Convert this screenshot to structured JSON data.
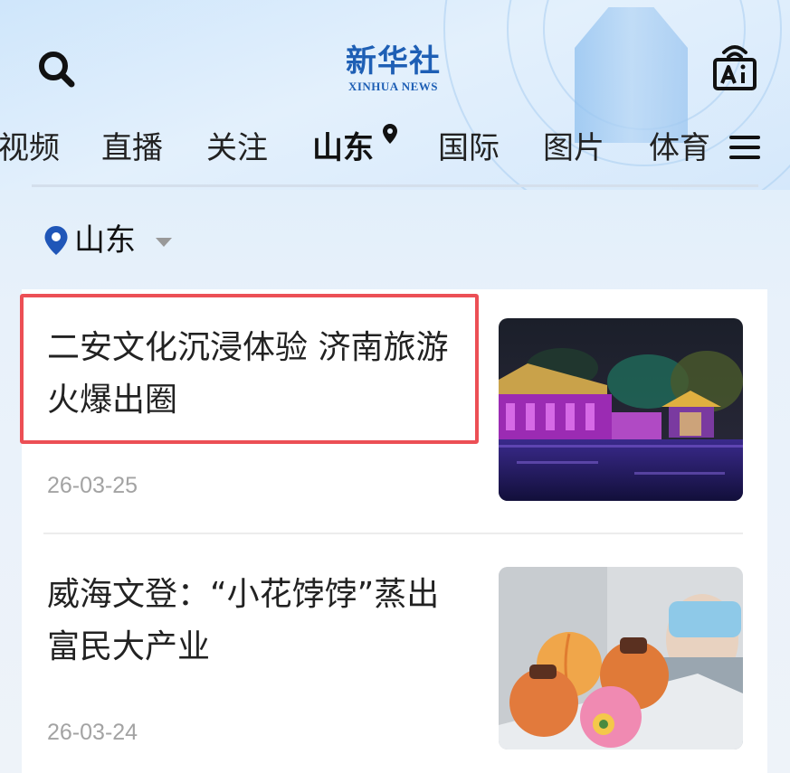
{
  "app": {
    "logo_cn": "新华社",
    "logo_en": "XINHUA NEWS"
  },
  "nav": {
    "tabs": [
      {
        "label": "视频"
      },
      {
        "label": "直播"
      },
      {
        "label": "关注"
      },
      {
        "label": "山东",
        "active": true
      },
      {
        "label": "国际"
      },
      {
        "label": "图片"
      },
      {
        "label": "体育"
      }
    ]
  },
  "region": {
    "label": "山东"
  },
  "articles": [
    {
      "title": "二安文化沉浸体验 济南旅游火爆出圈",
      "date": "26-03-25",
      "image": "night-scene-lit-pavilions-by-water"
    },
    {
      "title": "威海文登：“小花饽饽”蒸出富民大产业",
      "date": "26-03-24",
      "image": "worker-holding-tray-of-colorful-steamed-buns"
    }
  ],
  "colors": {
    "brand_blue": "#1e5fb5",
    "highlight_red": "#ec4f55",
    "pin_blue": "#1f56b8"
  },
  "icons": [
    "search-icon",
    "ai-broadcast-icon",
    "location-pin-icon",
    "menu-icon",
    "dropdown-caret-icon"
  ]
}
